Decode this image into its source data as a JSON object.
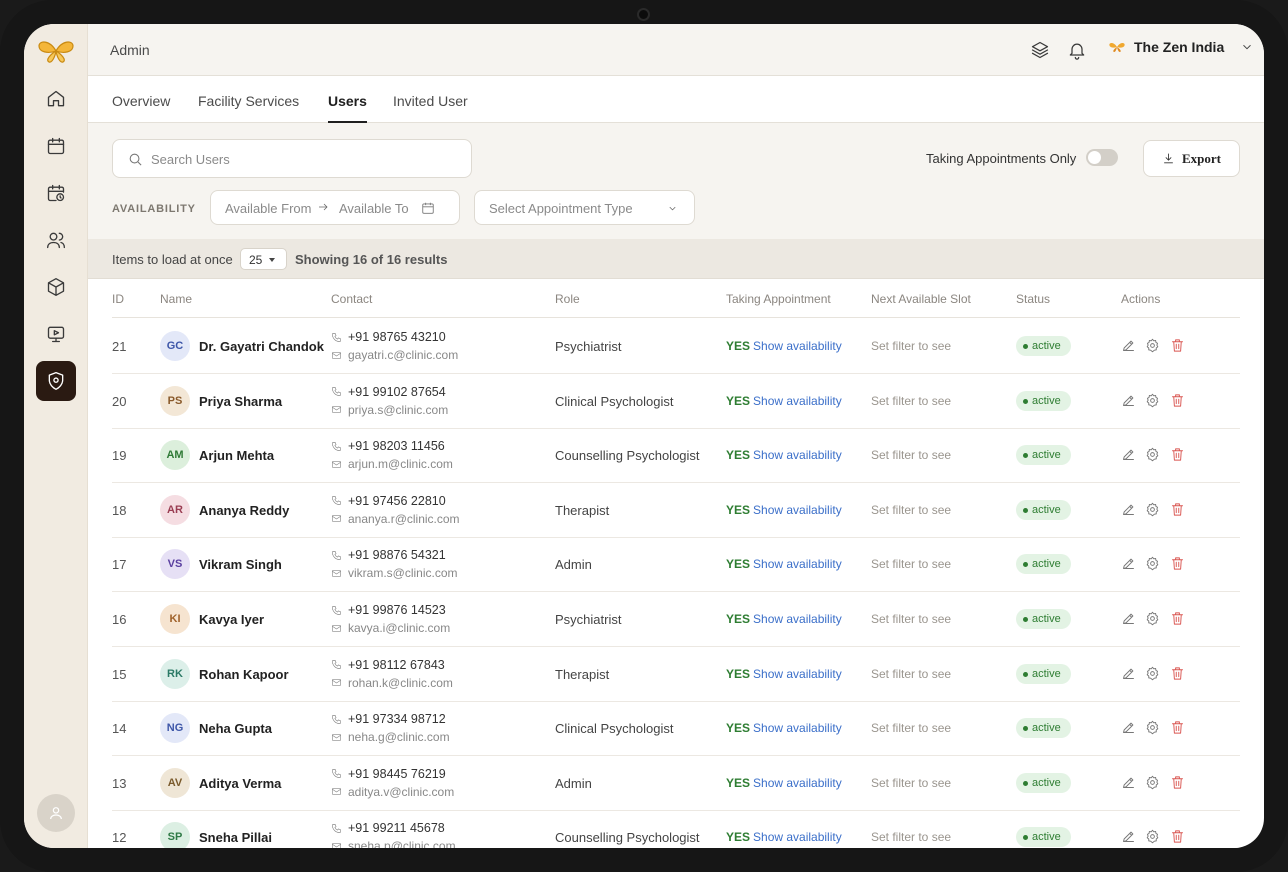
{
  "header": {
    "title": "Admin",
    "org_name": "The Zen India"
  },
  "tabs": [
    {
      "label": "Overview"
    },
    {
      "label": "Facility Services"
    },
    {
      "label": "Users"
    },
    {
      "label": "Invited User"
    }
  ],
  "active_tab": "Users",
  "filters": {
    "search_placeholder": "Search Users",
    "taking_appointments_label": "Taking Appointments Only",
    "taking_appointments_on": false,
    "export_label": "Export",
    "availability_label": "AVAILABILITY",
    "available_from_placeholder": "Available From",
    "available_to_placeholder": "Available To",
    "appointment_type_placeholder": "Select Appointment Type"
  },
  "pagination": {
    "items_label": "Items to load at once",
    "page_size": "25",
    "showing": "Showing 16 of 16 results"
  },
  "table": {
    "columns": [
      "ID",
      "Name",
      "Contact",
      "Role",
      "Taking Appointment",
      "Next Available Slot",
      "Status",
      "Actions"
    ],
    "rows": [
      {
        "id": "21",
        "initials": "GC",
        "name": "Dr. Gayatri Chandok",
        "phone": "+91 98765 43210",
        "email": "gayatri.c@clinic.com",
        "role": "Psychiatrist",
        "taking": "YES",
        "availability_link": "Show availability",
        "slot": "Set filter to see",
        "status": "active"
      },
      {
        "id": "20",
        "initials": "PS",
        "name": "Priya Sharma",
        "phone": "+91 99102 87654",
        "email": "priya.s@clinic.com",
        "role": "Clinical Psychologist",
        "taking": "YES",
        "availability_link": "Show availability",
        "slot": "Set filter to see",
        "status": "active"
      },
      {
        "id": "19",
        "initials": "AM",
        "name": "Arjun Mehta",
        "phone": "+91 98203 11456",
        "email": "arjun.m@clinic.com",
        "role": "Counselling Psychologist",
        "taking": "YES",
        "availability_link": "Show availability",
        "slot": "Set filter to see",
        "status": "active"
      },
      {
        "id": "18",
        "initials": "AR",
        "name": "Ananya Reddy",
        "phone": "+91 97456 22810",
        "email": "ananya.r@clinic.com",
        "role": "Therapist",
        "taking": "YES",
        "availability_link": "Show availability",
        "slot": "Set filter to see",
        "status": "active"
      },
      {
        "id": "17",
        "initials": "VS",
        "name": "Vikram Singh",
        "phone": "+91 98876 54321",
        "email": "vikram.s@clinic.com",
        "role": "Admin",
        "taking": "YES",
        "availability_link": "Show availability",
        "slot": "Set filter to see",
        "status": "active"
      },
      {
        "id": "16",
        "initials": "KI",
        "name": "Kavya Iyer",
        "phone": "+91 99876 14523",
        "email": "kavya.i@clinic.com",
        "role": "Psychiatrist",
        "taking": "YES",
        "availability_link": "Show availability",
        "slot": "Set filter to see",
        "status": "active"
      },
      {
        "id": "15",
        "initials": "RK",
        "name": "Rohan Kapoor",
        "phone": "+91 98112 67843",
        "email": "rohan.k@clinic.com",
        "role": "Therapist",
        "taking": "YES",
        "availability_link": "Show availability",
        "slot": "Set filter to see",
        "status": "active"
      },
      {
        "id": "14",
        "initials": "NG",
        "name": "Neha Gupta",
        "phone": "+91 97334 98712",
        "email": "neha.g@clinic.com",
        "role": "Clinical Psychologist",
        "taking": "YES",
        "availability_link": "Show availability",
        "slot": "Set filter to see",
        "status": "active"
      },
      {
        "id": "13",
        "initials": "AV",
        "name": "Aditya Verma",
        "phone": "+91 98445 76219",
        "email": "aditya.v@clinic.com",
        "role": "Admin",
        "taking": "YES",
        "availability_link": "Show availability",
        "slot": "Set filter to see",
        "status": "active"
      },
      {
        "id": "12",
        "initials": "SP",
        "name": "Sneha Pillai",
        "phone": "+91 99211 45678",
        "email": "sneha.p@clinic.com",
        "role": "Counselling Psychologist",
        "taking": "YES",
        "availability_link": "Show availability",
        "slot": "Set filter to see",
        "status": "active"
      }
    ]
  },
  "avatar_colors": [
    {
      "bg": "#e3e8f8",
      "fg": "#3d56a8"
    },
    {
      "bg": "#f3e7d6",
      "fg": "#8a5a2b"
    },
    {
      "bg": "#dcefdc",
      "fg": "#2f7a36"
    },
    {
      "bg": "#f5dde2",
      "fg": "#9a3d52"
    },
    {
      "bg": "#e6e0f5",
      "fg": "#5a3fa0"
    },
    {
      "bg": "#f6e4d0",
      "fg": "#a0622a"
    },
    {
      "bg": "#dcefe9",
      "fg": "#2b7a66"
    },
    {
      "bg": "#e3e8f8",
      "fg": "#3d56a8"
    },
    {
      "bg": "#efe6d6",
      "fg": "#7a5a2b"
    },
    {
      "bg": "#dcefe3",
      "fg": "#2f7a46"
    }
  ],
  "colors": {
    "accent_dark": "#2a1a12",
    "sidebar_bg": "#f1ebe1",
    "yes_green": "#2e7d32",
    "link_blue": "#3b6fc9",
    "delete_red": "#d9534f"
  },
  "icons": {
    "sidebar": [
      "home-icon",
      "calendar-icon",
      "calendar-clock-icon",
      "users-icon",
      "package-icon",
      "presentation-icon",
      "shield-icon"
    ],
    "topbar": [
      "layers-icon",
      "bell-icon",
      "butterfly-logo-icon",
      "chevron-down-icon"
    ],
    "row_actions": [
      "edit-icon",
      "settings-icon",
      "trash-icon"
    ]
  }
}
